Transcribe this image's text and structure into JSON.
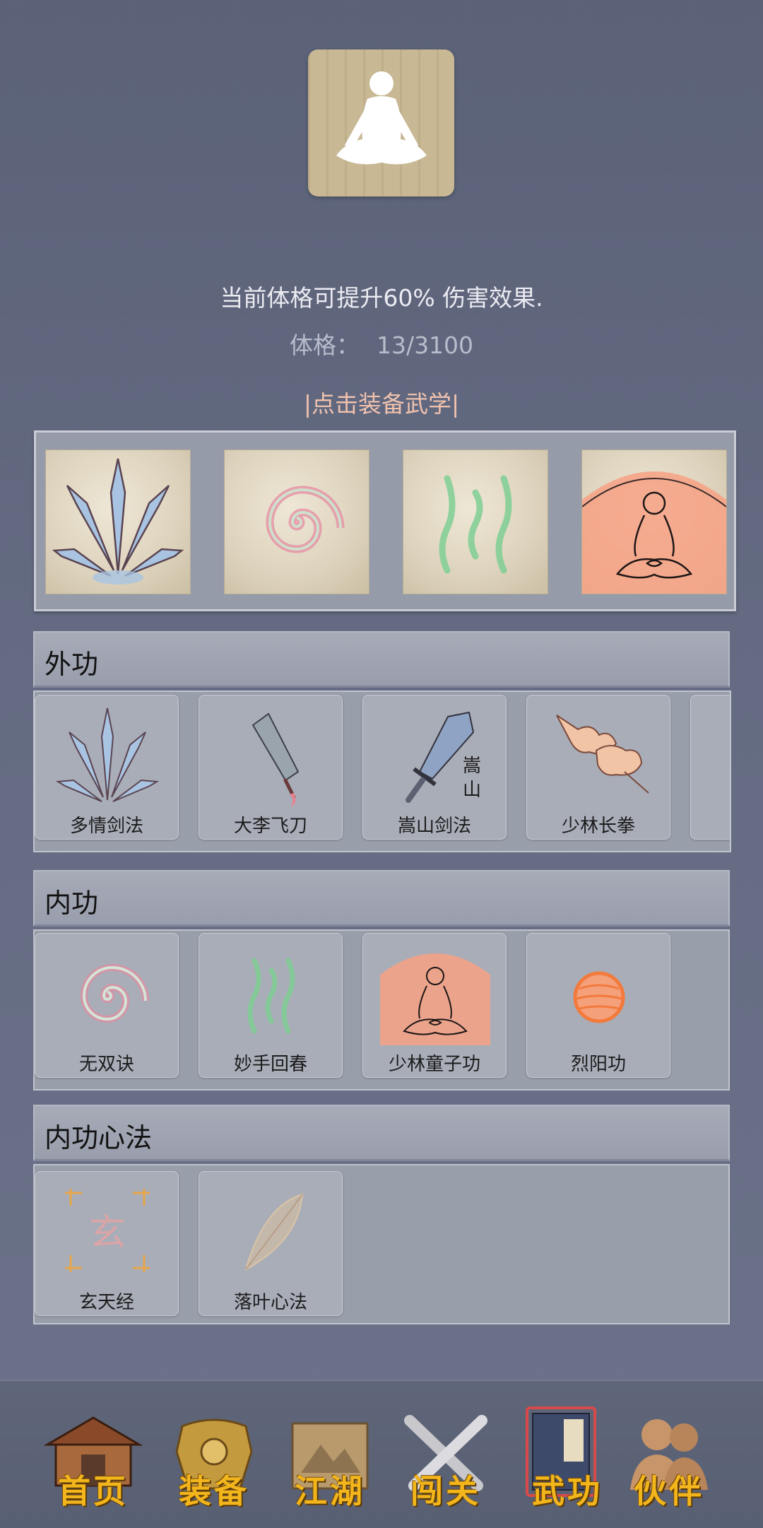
{
  "header": {
    "info_text": "当前体格可提升60% 伤害效果.",
    "constitution_label": "体格：",
    "constitution_value": "13/3100",
    "equip_hint": "|点击装备武学|"
  },
  "equipped": [
    {
      "icon": "blade-fan-icon"
    },
    {
      "icon": "swirl-icon"
    },
    {
      "icon": "heat-waves-icon"
    },
    {
      "icon": "monk-aura-icon"
    }
  ],
  "sections": {
    "external": {
      "title": "外功",
      "skills": [
        {
          "name": "多情剑法",
          "icon": "blade-fan-icon"
        },
        {
          "name": "大李飞刀",
          "icon": "cleaver-icon"
        },
        {
          "name": "嵩山剑法",
          "icon": "sword-icon",
          "glyph": "嵩\n山"
        },
        {
          "name": "少林长拳",
          "icon": "fist-icon"
        }
      ]
    },
    "internal": {
      "title": "内功",
      "skills": [
        {
          "name": "无双诀",
          "icon": "swirl-icon"
        },
        {
          "name": "妙手回春",
          "icon": "heat-waves-icon"
        },
        {
          "name": "少林童子功",
          "icon": "monk-aura-icon"
        },
        {
          "name": "烈阳功",
          "icon": "sun-orb-icon"
        }
      ]
    },
    "mental": {
      "title": "内功心法",
      "skills": [
        {
          "name": "玄天经",
          "icon": "xuan-glyph-icon",
          "glyph": "玄"
        },
        {
          "name": "落叶心法",
          "icon": "leaf-icon"
        }
      ]
    }
  },
  "tabbar": {
    "items": [
      {
        "label": "首页",
        "icon": "temple-icon"
      },
      {
        "label": "装备",
        "icon": "armor-icon"
      },
      {
        "label": "江湖",
        "icon": "scroll-map-icon"
      },
      {
        "label": "闯关",
        "icon": "crossed-swords-icon"
      },
      {
        "label": "武功",
        "icon": "book-icon"
      },
      {
        "label": "伙伴",
        "icon": "companions-icon"
      }
    ]
  }
}
